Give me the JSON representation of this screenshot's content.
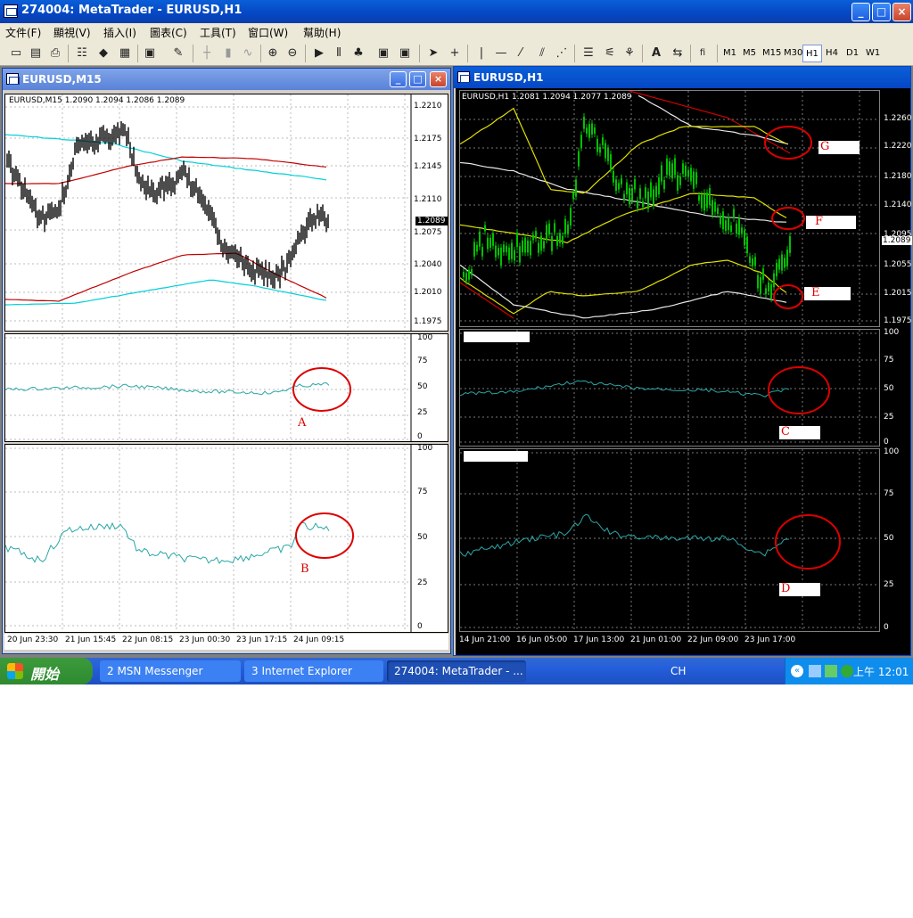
{
  "app": {
    "title": "274004: MetaTrader - EURUSD,H1",
    "min": "_",
    "max": "□",
    "close": "×"
  },
  "menu": [
    "文件(F)",
    "顯視(V)",
    "插入(I)",
    "圖表(C)",
    "工具(T)",
    "窗口(W)",
    "幫助(H)"
  ],
  "toolbar": {
    "timeframes": [
      "M1",
      "M5",
      "M15",
      "M30",
      "H1",
      "H4",
      "D1",
      "W1"
    ],
    "active_timeframe": "H1",
    "icons": [
      "new-chart-icon",
      "open-icon",
      "save-icon",
      "print-icon",
      "market-watch-icon",
      "navigator-icon",
      "terminal-icon",
      "tester-icon",
      "expert-icon",
      "hand-icon",
      "bar-chart-icon",
      "candle-icon",
      "line-chart-icon",
      "zoom-in-icon",
      "zoom-out-icon",
      "autoscroll-icon",
      "shift-icon",
      "indicators-icon",
      "periods-icon",
      "templates-icon",
      "cursor-icon",
      "crosshair-icon",
      "vline-icon",
      "hline-icon",
      "trendline-icon",
      "channel-icon",
      "gann-icon",
      "fibo-icon",
      "text-icon",
      "arrow-icon",
      "fibo-tools-icon"
    ],
    "text_tool": "A",
    "fibo_tool": "fi"
  },
  "left_window": {
    "title": "EURUSD,M15",
    "info": "EURUSD,M15  1.2090  1.2094  1.2086  1.2089",
    "price_axis": [
      "1.2210",
      "1.2175",
      "1.2145",
      "1.2110",
      "1.2075",
      "1.2040",
      "1.2010",
      "1.1975"
    ],
    "current_price": "1.2089",
    "osc_axis": [
      "100",
      "75",
      "50",
      "25",
      "0"
    ],
    "time_axis": [
      "20 Jun 23:30",
      "21 Jun 15:45",
      "22 Jun 08:15",
      "23 Jun 00:30",
      "23 Jun 17:15",
      "24 Jun 09:15"
    ],
    "marker_a": "A",
    "marker_b": "B"
  },
  "right_window": {
    "title": "EURUSD,H1",
    "info": "EURUSD,H1  1.2081  1.2094  1.2077  1.2089",
    "price_axis": [
      "1.2260",
      "1.2220",
      "1.2180",
      "1.2140",
      "1.2095",
      "1.2055",
      "1.2015",
      "1.1975"
    ],
    "current_price": "1.2089",
    "osc_axis": [
      "100",
      "75",
      "50",
      "25",
      "0"
    ],
    "time_axis": [
      "14 Jun 21:00",
      "16 Jun 05:00",
      "17 Jun 13:00",
      "21 Jun 01:00",
      "22 Jun 09:00",
      "23 Jun 17:00"
    ],
    "marker_c": "C",
    "marker_d": "D",
    "marker_e": "E",
    "marker_f": "F",
    "marker_g": "G"
  },
  "taskbar": {
    "start": "開始",
    "tasks": [
      "2 MSN Messenger",
      "3 Internet Explorer",
      "274004: MetaTrader - ..."
    ],
    "lang": "CH",
    "clock": "上午 12:01"
  },
  "colors": {
    "title_blue": "#0546c4",
    "chart_bg_right": "#000000",
    "candle_up": "#00c000",
    "osc_line": "#2aa6a6",
    "marker_red": "#dd0000"
  }
}
